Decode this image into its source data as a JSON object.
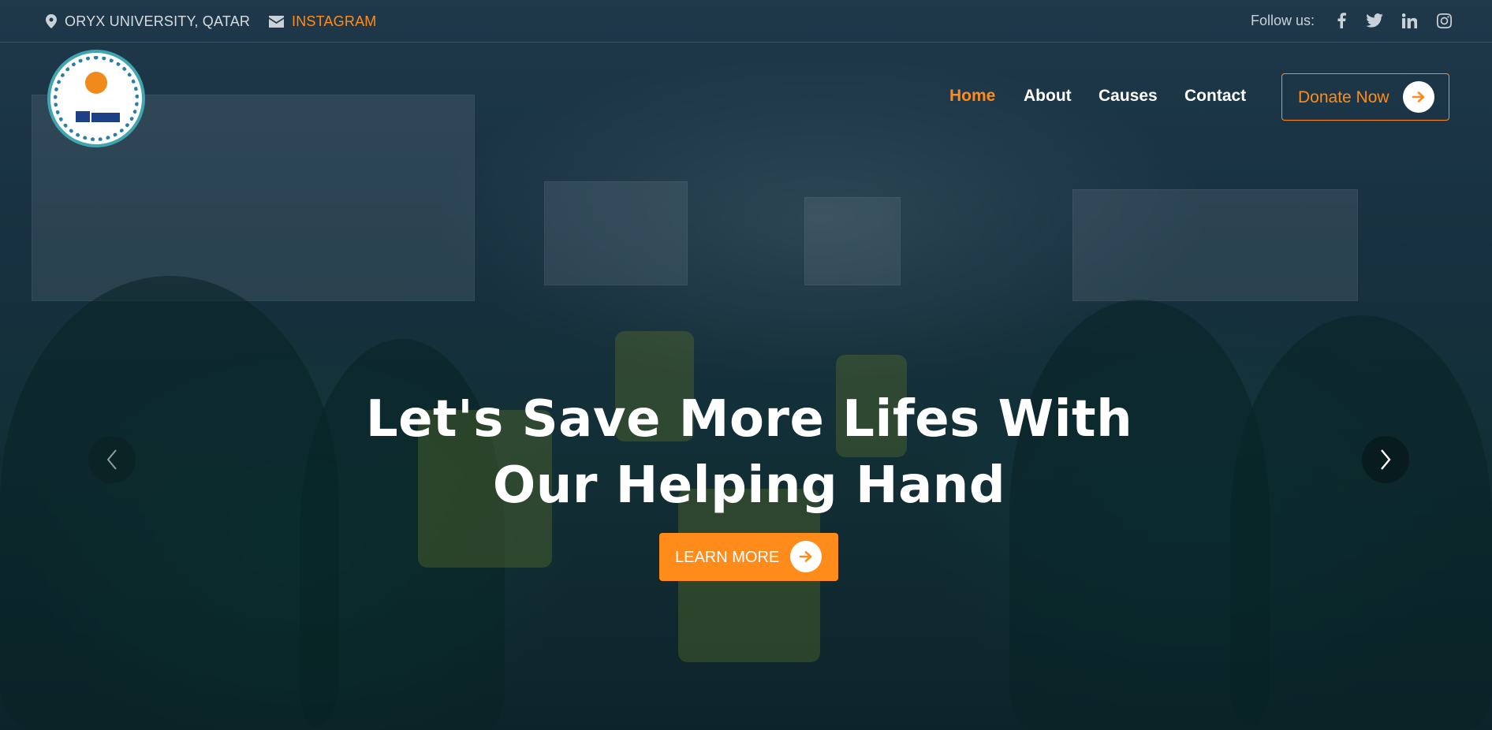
{
  "topbar": {
    "location": "ORYX UNIVERSITY, QATAR",
    "location_icon": "map-pin-icon",
    "instagram": "INSTAGRAM",
    "instagram_icon": "envelope-icon",
    "follow_label": "Follow us:",
    "social_icons": [
      "facebook-icon",
      "twitter-icon",
      "linkedin-icon",
      "instagram-icon"
    ]
  },
  "nav": {
    "items": [
      {
        "label": "Home",
        "active": true
      },
      {
        "label": "About",
        "active": false
      },
      {
        "label": "Causes",
        "active": false
      },
      {
        "label": "Contact",
        "active": false
      }
    ],
    "donate_label": "Donate Now"
  },
  "hero": {
    "headline_line1": "Let's Save More Lifes With",
    "headline_line2": "Our Helping Hand",
    "cta_label": "LEARN MORE"
  },
  "colors": {
    "accent": "#ff8c1a",
    "text_light": "#ffffff",
    "muted": "#c9d2d8"
  }
}
